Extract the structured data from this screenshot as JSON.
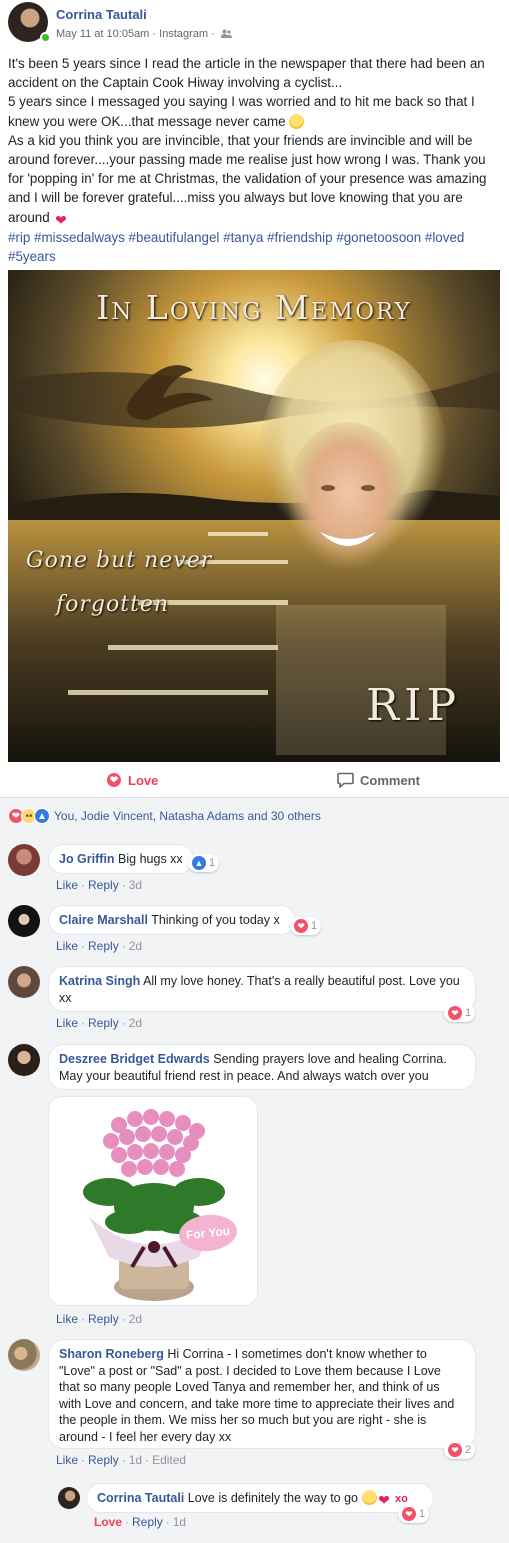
{
  "post": {
    "author": "Corrina Tautali",
    "date": "May 11 at 10:05am",
    "source": "Instagram",
    "text_lines": [
      "It's been 5 years since I read the article in the newspaper that there had been an accident on the Captain Cook Hiway involving a cyclist...",
      "5 years since I messaged you saying I was worried and to hit me back so that I knew you were OK...that message never came",
      "As a kid you think you are invincible, that your friends are invincible and will be around forever....your passing made me realise just how wrong I was. Thank you for 'popping in' for me at Christmas, the validation of your presence was amazing and I will be forever grateful....miss you always but love knowing that you are around"
    ],
    "hashtags": "#rip #missedalways #beautifulangel #tanya #friendship #gonetoosoon #loved #5years",
    "image_texts": {
      "title": "In Loving Memory",
      "line1": "Gone but never",
      "line2": "forgotten",
      "rip": "RIP"
    }
  },
  "actions": {
    "love": "Love",
    "comment": "Comment"
  },
  "reactions": {
    "summary": "You, Jodie Vincent, Natasha Adams and 30 others"
  },
  "comments": [
    {
      "name": "Jo Griffin",
      "text": "Big hugs xx",
      "like": "Like",
      "reply": "Reply",
      "time": "3d",
      "reaction_count": "1"
    },
    {
      "name": "Claire Marshall",
      "text": "Thinking of you today x",
      "like": "Like",
      "reply": "Reply",
      "time": "2d",
      "reaction_count": "1"
    },
    {
      "name": "Katrina Singh",
      "text": "All my love honey. That's a really beautiful post. Love you xx",
      "like": "Like",
      "reply": "Reply",
      "time": "2d",
      "reaction_count": "1"
    },
    {
      "name": "Deszree Bridget Edwards",
      "text": "Sending prayers love and healing Corrina. May your beautiful friend rest in peace. And always watch over you",
      "like": "Like",
      "reply": "Reply",
      "time": "2d",
      "image_label": "For You"
    },
    {
      "name": "Sharon Roneberg",
      "text": "Hi Corrina - I sometimes don't know whether to \"Love\" a post or \"Sad\" a post. I decided to Love them because I Love that so many people Loved Tanya and remember her, and think of us with Love and concern, and take more time to appreciate their lives and the people in them. We miss her so much but you are right - she is around - I feel her every day xx",
      "like": "Like",
      "reply": "Reply",
      "time": "1d",
      "edited": "Edited",
      "reaction_count": "2"
    },
    {
      "name": "Corrina Tautali",
      "text": "Love is definitely the way to go",
      "suffix": "xo",
      "like": "Love",
      "reply": "Reply",
      "time": "1d",
      "reaction_count": "1"
    }
  ]
}
